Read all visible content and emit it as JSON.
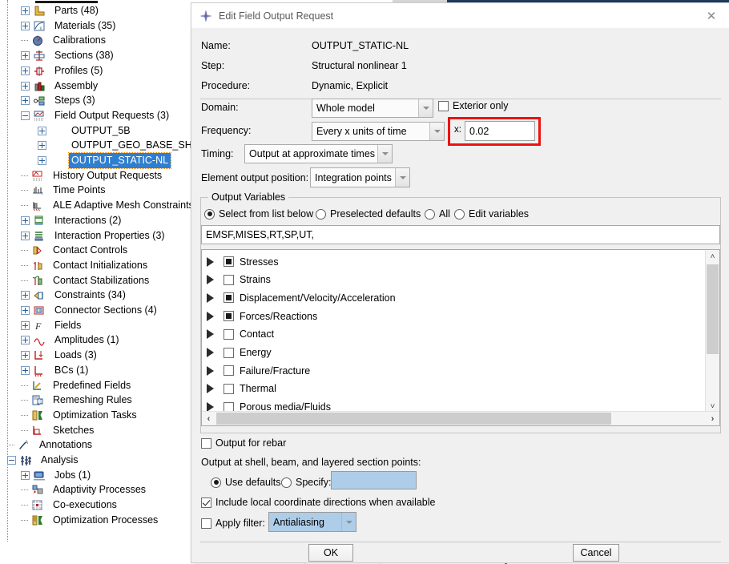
{
  "tree": {
    "items": [
      {
        "label": "Parts (48)",
        "icon": "parts-icon",
        "indent": 26,
        "expander": "plus"
      },
      {
        "label": "Materials (35)",
        "icon": "materials-icon",
        "indent": 26,
        "expander": "plus"
      },
      {
        "label": "Calibrations",
        "icon": "calibrations-icon",
        "indent": 26,
        "expander": "none"
      },
      {
        "label": "Sections (38)",
        "icon": "sections-icon",
        "indent": 26,
        "expander": "plus"
      },
      {
        "label": "Profiles (5)",
        "icon": "profiles-icon",
        "indent": 26,
        "expander": "plus"
      },
      {
        "label": "Assembly",
        "icon": "assembly-icon",
        "indent": 26,
        "expander": "plus"
      },
      {
        "label": "Steps (3)",
        "icon": "steps-icon",
        "indent": 26,
        "expander": "plus"
      },
      {
        "label": "Field Output Requests (3)",
        "icon": "field-output-icon",
        "indent": 26,
        "expander": "minus"
      },
      {
        "label": "OUTPUT_5B",
        "icon": "none",
        "indent": 47,
        "expander": "plus"
      },
      {
        "label": "OUTPUT_GEO_BASE_SHEAR_TB",
        "icon": "none",
        "indent": 47,
        "expander": "plus"
      },
      {
        "label": "OUTPUT_STATIC-NL",
        "icon": "none",
        "indent": 47,
        "expander": "plus",
        "selected": true
      },
      {
        "label": "History Output Requests",
        "icon": "history-output-icon",
        "indent": 26,
        "expander": "none"
      },
      {
        "label": "Time Points",
        "icon": "time-points-icon",
        "indent": 26,
        "expander": "none"
      },
      {
        "label": "ALE Adaptive Mesh Constraints",
        "icon": "ale-mesh-icon",
        "indent": 26,
        "expander": "none"
      },
      {
        "label": "Interactions (2)",
        "icon": "interactions-icon",
        "indent": 26,
        "expander": "plus"
      },
      {
        "label": "Interaction Properties (3)",
        "icon": "interaction-props-icon",
        "indent": 26,
        "expander": "plus"
      },
      {
        "label": "Contact Controls",
        "icon": "contact-controls-icon",
        "indent": 26,
        "expander": "none"
      },
      {
        "label": "Contact Initializations",
        "icon": "contact-init-icon",
        "indent": 26,
        "expander": "none"
      },
      {
        "label": "Contact Stabilizations",
        "icon": "contact-stab-icon",
        "indent": 26,
        "expander": "none"
      },
      {
        "label": "Constraints (34)",
        "icon": "constraints-icon",
        "indent": 26,
        "expander": "plus"
      },
      {
        "label": "Connector Sections (4)",
        "icon": "connector-sections-icon",
        "indent": 26,
        "expander": "plus"
      },
      {
        "label": "Fields",
        "icon": "fields-icon",
        "indent": 26,
        "expander": "plus"
      },
      {
        "label": "Amplitudes (1)",
        "icon": "amplitudes-icon",
        "indent": 26,
        "expander": "plus"
      },
      {
        "label": "Loads (3)",
        "icon": "loads-icon",
        "indent": 26,
        "expander": "plus"
      },
      {
        "label": "BCs (1)",
        "icon": "bcs-icon",
        "indent": 26,
        "expander": "plus"
      },
      {
        "label": "Predefined Fields",
        "icon": "predefined-fields-icon",
        "indent": 26,
        "expander": "none"
      },
      {
        "label": "Remeshing Rules",
        "icon": "remeshing-rules-icon",
        "indent": 26,
        "expander": "none"
      },
      {
        "label": "Optimization Tasks",
        "icon": "optimization-tasks-icon",
        "indent": 26,
        "expander": "none"
      },
      {
        "label": "Sketches",
        "icon": "sketches-icon",
        "indent": 26,
        "expander": "none"
      },
      {
        "label": "Annotations",
        "icon": "annotations-icon",
        "indent": 9,
        "expander": "none"
      },
      {
        "label": "Analysis",
        "icon": "analysis-icon",
        "indent": 9,
        "expander": "minus"
      },
      {
        "label": "Jobs (1)",
        "icon": "jobs-icon",
        "indent": 26,
        "expander": "plus"
      },
      {
        "label": "Adaptivity Processes",
        "icon": "adaptivity-icon",
        "indent": 26,
        "expander": "none"
      },
      {
        "label": "Co-executions",
        "icon": "coexecutions-icon",
        "indent": 26,
        "expander": "none"
      },
      {
        "label": "Optimization Processes",
        "icon": "optimization-proc-icon",
        "indent": 26,
        "expander": "none"
      }
    ]
  },
  "dialog": {
    "title": "Edit Field Output Request",
    "close_glyph": "✕",
    "fields": {
      "name_label": "Name:",
      "name_value": "OUTPUT_STATIC-NL",
      "step_label": "Step:",
      "step_value": "Structural nonlinear 1",
      "procedure_label": "Procedure:",
      "procedure_value": "Dynamic, Explicit"
    },
    "domain": {
      "label": "Domain:",
      "value": "Whole model",
      "exterior_only_label": "Exterior only",
      "exterior_only_checked": false
    },
    "frequency": {
      "label": "Frequency:",
      "value": "Every x units of time",
      "x_label": "x:",
      "x_value": "0.02",
      "highlight_color": "#ee1111"
    },
    "timing": {
      "label": "Timing:",
      "value": "Output at approximate times"
    },
    "element_output_position": {
      "label": "Element output position:",
      "value": "Integration points"
    },
    "output_variables": {
      "group_title": "Output Variables",
      "options": [
        {
          "label": "Select from list below",
          "selected": true
        },
        {
          "label": "Preselected defaults",
          "selected": false
        },
        {
          "label": "All",
          "selected": false
        },
        {
          "label": "Edit variables",
          "selected": false
        }
      ],
      "variables_text": "EMSF,MISES,RT,SP,UT,",
      "list": [
        {
          "label": "Stresses",
          "state": "partial"
        },
        {
          "label": "Strains",
          "state": "unchecked"
        },
        {
          "label": "Displacement/Velocity/Acceleration",
          "state": "partial"
        },
        {
          "label": "Forces/Reactions",
          "state": "partial"
        },
        {
          "label": "Contact",
          "state": "unchecked"
        },
        {
          "label": "Energy",
          "state": "unchecked"
        },
        {
          "label": "Failure/Fracture",
          "state": "unchecked"
        },
        {
          "label": "Thermal",
          "state": "unchecked"
        },
        {
          "label": "Porous media/Fluids",
          "state": "unchecked"
        }
      ],
      "scroll_up_glyph": "˄",
      "scroll_down_glyph": "˅",
      "scroll_left_glyph": "‹",
      "scroll_right_glyph": "›"
    },
    "rebar": {
      "label": "Output for rebar",
      "checked": false
    },
    "section_points": {
      "label": "Output at shell, beam, and layered section points:",
      "use_defaults_label": "Use defaults",
      "use_defaults_selected": true,
      "specify_label": "Specify:",
      "specify_selected": false,
      "specify_value": ""
    },
    "local_coords": {
      "label": "Include local coordinate directions when available",
      "checked": true
    },
    "filter": {
      "label": "Apply filter:",
      "checked": false,
      "value": "Antialiasing"
    },
    "buttons": {
      "ok": "OK",
      "cancel": "Cancel"
    }
  }
}
